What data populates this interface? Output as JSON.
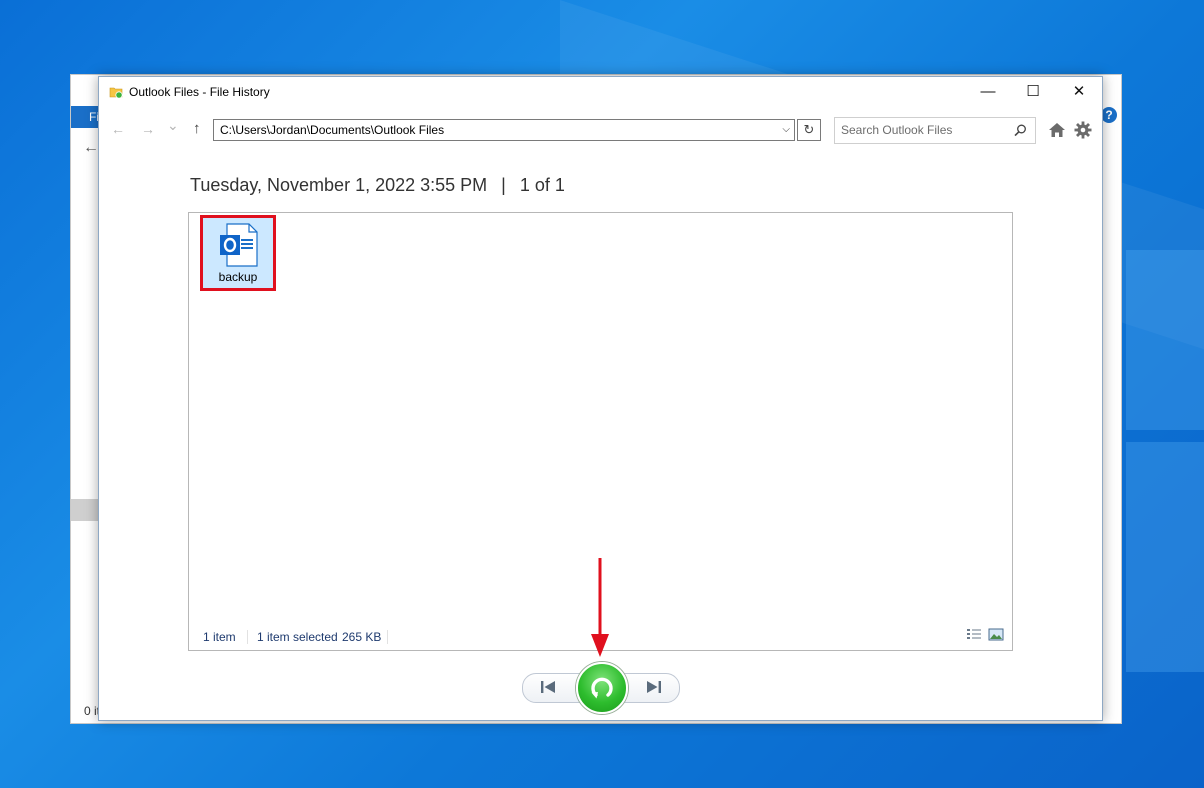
{
  "background_window": {
    "ribbon_label": "Fi",
    "status_fragment": "0 it",
    "help_label": "?"
  },
  "window": {
    "title": "Outlook Files - File History",
    "controls": {
      "minimize": "—",
      "maximize": "☐",
      "close": "✕"
    }
  },
  "toolbar": {
    "back": "←",
    "forward": "→",
    "recent": "⌄",
    "up": "↑",
    "address": "C:\\Users\\Jordan\\Documents\\Outlook Files",
    "search_placeholder": "Search Outlook Files"
  },
  "header": {
    "date": "Tuesday, November 1, 2022 3:55 PM",
    "separator": "|",
    "page_indicator": "1 of 1"
  },
  "files": [
    {
      "name": "backup",
      "icon": "outlook-data-file-icon",
      "selected": true
    }
  ],
  "status": {
    "item_count": "1 item",
    "selection": "1 item selected",
    "size": "265 KB"
  },
  "colors": {
    "accent": "#1a6fc8",
    "selection": "#cce8ff",
    "highlight_box": "#e0101e",
    "restore_green": "#2ebd2e",
    "annotation_arrow": "#e0101e"
  }
}
